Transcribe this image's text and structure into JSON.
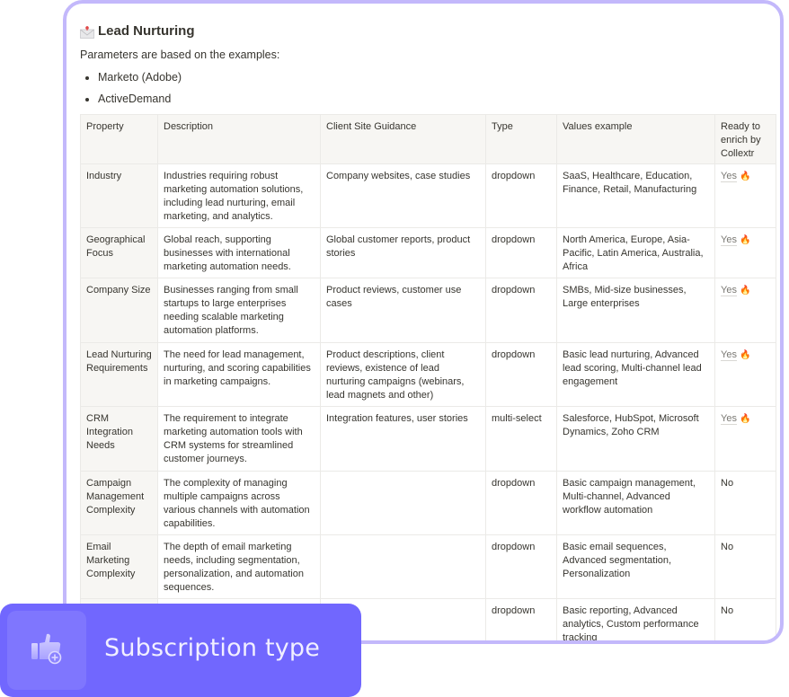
{
  "page": {
    "title": "Lead Nurturing",
    "title_icon": "envelope-icon",
    "intro": "Parameters are based on the examples:",
    "examples": [
      "Marketo (Adobe)",
      "ActiveDemand"
    ]
  },
  "table": {
    "headers": [
      "Property",
      "Description",
      "Client Site Guidance",
      "Type",
      "Values example",
      "Ready to enrich by Collextr"
    ],
    "rows": [
      {
        "property": "Industry",
        "description": "Industries requiring robust marketing automation solutions, including lead nurturing, email marketing, and analytics.",
        "guidance": "Company websites, case studies",
        "type": "dropdown",
        "values": "SaaS, Healthcare, Education, Finance, Retail, Manufacturing",
        "ready": "Yes",
        "ready_icon": "🔥"
      },
      {
        "property": "Geographical Focus",
        "description": "Global reach, supporting businesses with international marketing automation needs.",
        "guidance": "Global customer reports, product stories",
        "type": "dropdown",
        "values": "North America, Europe, Asia-Pacific, Latin America, Australia, Africa",
        "ready": "Yes",
        "ready_icon": "🔥"
      },
      {
        "property": "Company Size",
        "description": "Businesses ranging from small startups to large enterprises needing scalable marketing automation platforms.",
        "guidance": "Product reviews, customer use cases",
        "type": "dropdown",
        "values": "SMBs, Mid-size businesses, Large enterprises",
        "ready": "Yes",
        "ready_icon": "🔥"
      },
      {
        "property": "Lead Nurturing Requirements",
        "description": "The need for lead management, nurturing, and scoring capabilities in marketing campaigns.",
        "guidance": "Product descriptions, client reviews, existence of lead nurturing campaigns (webinars, lead magnets and other)",
        "type": "dropdown",
        "values": "Basic lead nurturing, Advanced lead scoring, Multi-channel lead engagement",
        "ready": "Yes",
        "ready_icon": "🔥"
      },
      {
        "property": "CRM Integration Needs",
        "description": "The requirement to integrate marketing automation tools with CRM systems for streamlined customer journeys.",
        "guidance": "Integration features, user stories",
        "type": "multi-select",
        "values": "Salesforce, HubSpot, Microsoft Dynamics, Zoho CRM",
        "ready": "Yes",
        "ready_icon": "🔥"
      },
      {
        "property": "Campaign Management Complexity",
        "description": "The complexity of managing multiple campaigns across various channels with automation capabilities.",
        "guidance": "",
        "type": "dropdown",
        "values": "Basic campaign management, Multi-channel, Advanced workflow automation",
        "ready": "No",
        "ready_icon": ""
      },
      {
        "property": "Email Marketing Complexity",
        "description": "The depth of email marketing needs, including segmentation, personalization, and automation sequences.",
        "guidance": "",
        "type": "dropdown",
        "values": "Basic email sequences, Advanced segmentation, Personalization",
        "ready": "No",
        "ready_icon": ""
      },
      {
        "property": "",
        "description": "",
        "guidance": "",
        "type": "dropdown",
        "values": "Basic reporting, Advanced analytics, Custom performance tracking",
        "ready": "No",
        "ready_icon": ""
      }
    ]
  },
  "banner": {
    "label": "Subscription type",
    "icon": "thumbs-up-plus-icon"
  },
  "colors": {
    "card_border": "#c3b8fb",
    "banner_bg": "#7167fe",
    "header_bg": "#f7f6f3"
  }
}
